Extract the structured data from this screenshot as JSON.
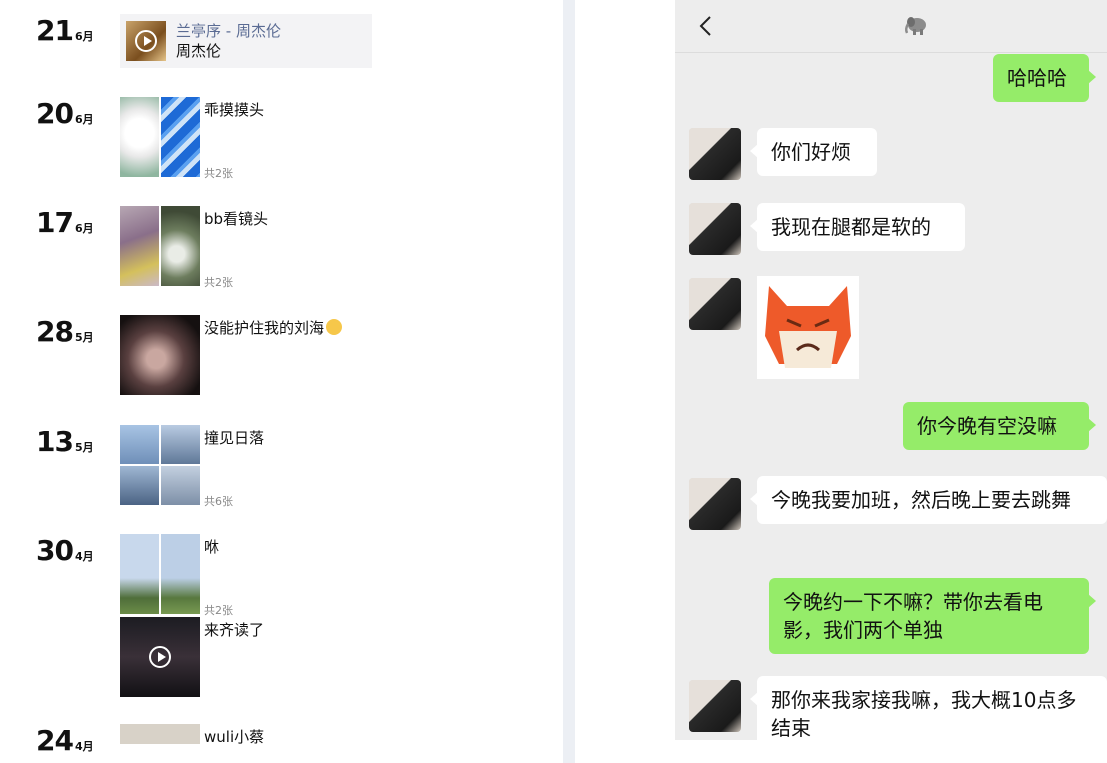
{
  "moments": {
    "entries": [
      {
        "day": "21",
        "month": "6月",
        "music_title": "兰亭序 - 周杰伦",
        "music_artist": "周杰伦"
      },
      {
        "day": "20",
        "month": "6月",
        "caption": "乖摸摸头",
        "count": "共2张"
      },
      {
        "day": "17",
        "month": "6月",
        "caption": "bb看镜头",
        "count": "共2张"
      },
      {
        "day": "28",
        "month": "5月",
        "caption": "没能护住我的刘海"
      },
      {
        "day": "13",
        "month": "5月",
        "caption": "撞见日落",
        "count": "共6张"
      },
      {
        "day": "30",
        "month": "4月",
        "caption": "咻",
        "count": "共2张"
      },
      {
        "caption": "来齐读了"
      },
      {
        "day": "24",
        "month": "4月",
        "caption": "wuli小蔡"
      }
    ]
  },
  "chat": {
    "messages": [
      {
        "side": "out",
        "text": "哈哈哈"
      },
      {
        "side": "in",
        "text": "你们好烦"
      },
      {
        "side": "in",
        "text": "我现在腿都是软的"
      },
      {
        "side": "in",
        "type": "sticker"
      },
      {
        "side": "out",
        "text": "你今晚有空没嘛"
      },
      {
        "side": "in",
        "text": "今晚我要加班，然后晚上要去跳舞"
      },
      {
        "side": "out",
        "text": "今晚约一下不嘛？带你去看电影，我们两个单独"
      },
      {
        "side": "in",
        "text": "那你来我家接我嘛，我大概10点多结束"
      }
    ]
  },
  "icons": {
    "back": "chevron-left-icon",
    "title": "elephant-icon",
    "play": "play-circle-icon"
  },
  "colors": {
    "sent_bubble": "#95ec69",
    "received_bubble": "#ffffff",
    "chat_background": "#ededed",
    "music_title": "#5a6b93"
  }
}
